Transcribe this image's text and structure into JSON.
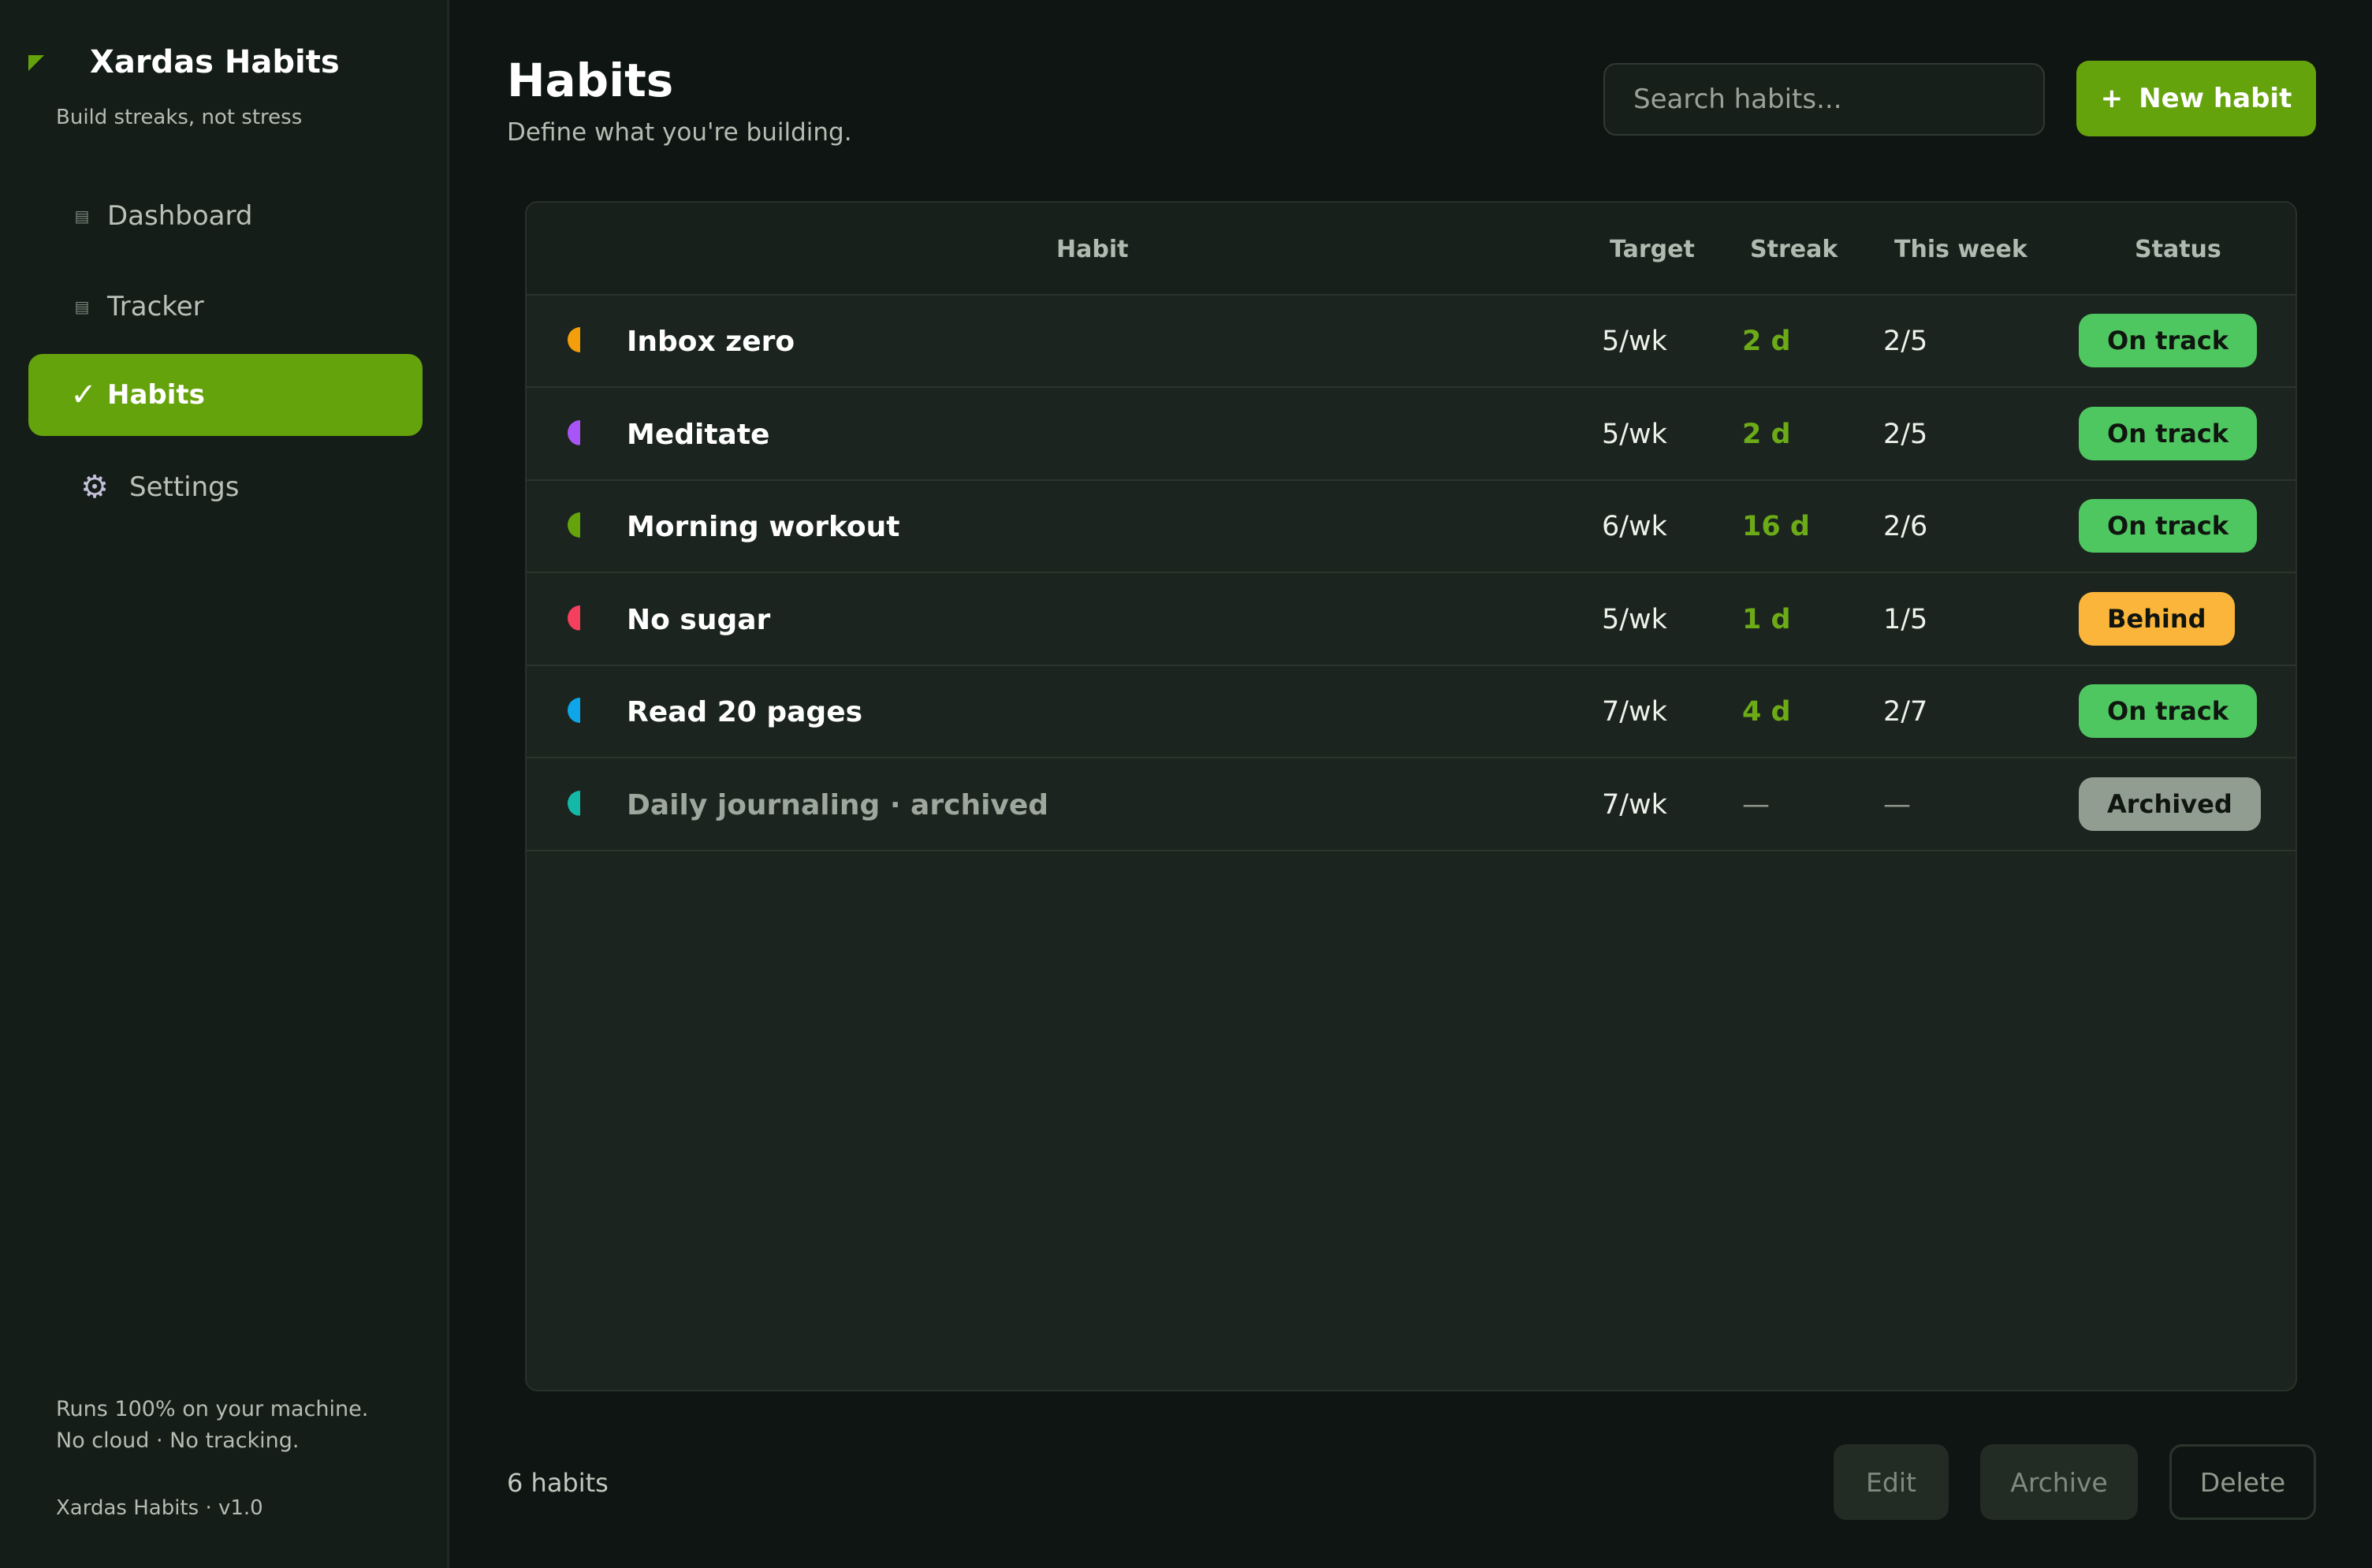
{
  "app": {
    "name": "Xardas Habits",
    "tagline": "Build streaks, not stress",
    "version": "Xardas Habits · v1.0",
    "privacy_line1": "Runs 100% on your machine.",
    "privacy_line2": "No cloud · No tracking.",
    "accent_color": "#65a30d"
  },
  "sidebar": {
    "items": [
      {
        "label": "Dashboard",
        "icon": "list-icon",
        "active": false
      },
      {
        "label": "Tracker",
        "icon": "list-icon",
        "active": false
      },
      {
        "label": "Habits",
        "icon": "check-icon",
        "active": true
      },
      {
        "label": "Settings",
        "icon": "gear-icon",
        "active": false
      }
    ]
  },
  "header": {
    "title": "Habits",
    "subtitle": "Define what you're building.",
    "search_placeholder": "Search habits...",
    "new_button_label": "New habit",
    "new_button_icon": "+"
  },
  "table": {
    "columns": {
      "habit": "Habit",
      "target": "Target",
      "streak": "Streak",
      "week": "This week",
      "status": "Status"
    },
    "rows": [
      {
        "name": "Inbox zero",
        "dot_color": "#f59e0b",
        "target": "5/wk",
        "streak": "2 d",
        "week": "2/5",
        "status": "On track",
        "status_color": "#4fc760"
      },
      {
        "name": "Meditate",
        "dot_color": "#a855f7",
        "target": "5/wk",
        "streak": "2 d",
        "week": "2/5",
        "status": "On track",
        "status_color": "#4fc760"
      },
      {
        "name": "Morning workout",
        "dot_color": "#65a30d",
        "target": "6/wk",
        "streak": "16 d",
        "week": "2/6",
        "status": "On track",
        "status_color": "#4fc760"
      },
      {
        "name": "No sugar",
        "dot_color": "#f43f5e",
        "target": "5/wk",
        "streak": "1 d",
        "week": "1/5",
        "status": "Behind",
        "status_color": "#fbb53b"
      },
      {
        "name": "Read 20 pages",
        "dot_color": "#0ea5e9",
        "target": "7/wk",
        "streak": "4 d",
        "week": "2/7",
        "status": "On track",
        "status_color": "#4fc760"
      },
      {
        "name": "Daily journaling  ·  archived",
        "dot_color": "#14b8a6",
        "target": "7/wk",
        "streak": "—",
        "week": "—",
        "status": "Archived",
        "status_color": "#929d91"
      }
    ]
  },
  "footer": {
    "count": "6 habits",
    "edit_label": "Edit",
    "archive_label": "Archive",
    "delete_label": "Delete"
  }
}
